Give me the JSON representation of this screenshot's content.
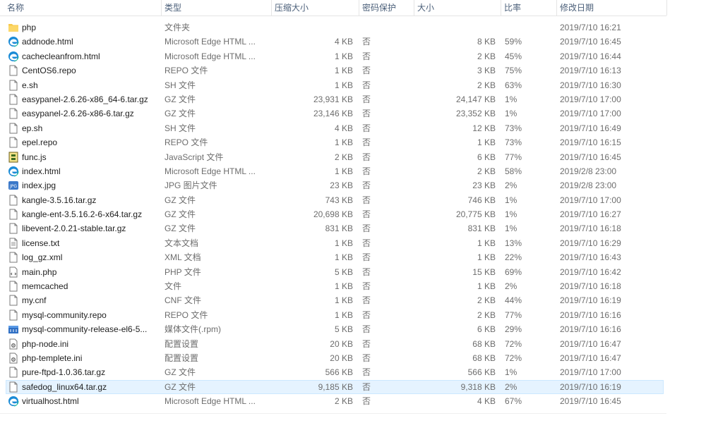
{
  "columns": {
    "name": "名称",
    "type": "类型",
    "compressed": "压缩大小",
    "password": "密码保护",
    "size": "大小",
    "ratio": "比率",
    "modified": "修改日期"
  },
  "colors": {
    "selection": "#e5f3ff",
    "folder": "#f7c94b",
    "edge": "#1b8bd6",
    "header_text": "#4c607a"
  },
  "rows": [
    {
      "icon": "folder-icon",
      "name": "php",
      "type": "文件夹",
      "compressed": "",
      "password": "",
      "size": "",
      "ratio": "",
      "modified": "2019/7/10 16:21"
    },
    {
      "icon": "edge-icon",
      "name": "addnode.html",
      "type": "Microsoft Edge HTML ...",
      "compressed": "4 KB",
      "password": "否",
      "size": "8 KB",
      "ratio": "59%",
      "modified": "2019/7/10 16:45"
    },
    {
      "icon": "edge-icon",
      "name": "cachecleanfrom.html",
      "type": "Microsoft Edge HTML ...",
      "compressed": "1 KB",
      "password": "否",
      "size": "2 KB",
      "ratio": "45%",
      "modified": "2019/7/10 16:44"
    },
    {
      "icon": "file-icon",
      "name": "CentOS6.repo",
      "type": "REPO 文件",
      "compressed": "1 KB",
      "password": "否",
      "size": "3 KB",
      "ratio": "75%",
      "modified": "2019/7/10 16:13"
    },
    {
      "icon": "file-icon",
      "name": "e.sh",
      "type": "SH 文件",
      "compressed": "1 KB",
      "password": "否",
      "size": "2 KB",
      "ratio": "63%",
      "modified": "2019/7/10 16:30"
    },
    {
      "icon": "file-icon",
      "name": "easypanel-2.6.26-x86_64-6.tar.gz",
      "type": "GZ 文件",
      "compressed": "23,931 KB",
      "password": "否",
      "size": "24,147 KB",
      "ratio": "1%",
      "modified": "2019/7/10 17:00"
    },
    {
      "icon": "file-icon",
      "name": "easypanel-2.6.26-x86-6.tar.gz",
      "type": "GZ 文件",
      "compressed": "23,146 KB",
      "password": "否",
      "size": "23,352 KB",
      "ratio": "1%",
      "modified": "2019/7/10 17:00"
    },
    {
      "icon": "file-icon",
      "name": "ep.sh",
      "type": "SH 文件",
      "compressed": "4 KB",
      "password": "否",
      "size": "12 KB",
      "ratio": "73%",
      "modified": "2019/7/10 16:49"
    },
    {
      "icon": "file-icon",
      "name": "epel.repo",
      "type": "REPO 文件",
      "compressed": "1 KB",
      "password": "否",
      "size": "1 KB",
      "ratio": "73%",
      "modified": "2019/7/10 16:15"
    },
    {
      "icon": "js-icon",
      "name": "func.js",
      "type": "JavaScript 文件",
      "compressed": "2 KB",
      "password": "否",
      "size": "6 KB",
      "ratio": "77%",
      "modified": "2019/7/10 16:45"
    },
    {
      "icon": "edge-icon",
      "name": "index.html",
      "type": "Microsoft Edge HTML ...",
      "compressed": "1 KB",
      "password": "否",
      "size": "2 KB",
      "ratio": "58%",
      "modified": "2019/2/8 23:00"
    },
    {
      "icon": "image-icon",
      "name": "index.jpg",
      "type": "JPG 图片文件",
      "compressed": "23 KB",
      "password": "否",
      "size": "23 KB",
      "ratio": "2%",
      "modified": "2019/2/8 23:00"
    },
    {
      "icon": "file-icon",
      "name": "kangle-3.5.16.tar.gz",
      "type": "GZ 文件",
      "compressed": "743 KB",
      "password": "否",
      "size": "746 KB",
      "ratio": "1%",
      "modified": "2019/7/10 17:00"
    },
    {
      "icon": "file-icon",
      "name": "kangle-ent-3.5.16.2-6-x64.tar.gz",
      "type": "GZ 文件",
      "compressed": "20,698 KB",
      "password": "否",
      "size": "20,775 KB",
      "ratio": "1%",
      "modified": "2019/7/10 16:27"
    },
    {
      "icon": "file-icon",
      "name": "libevent-2.0.21-stable.tar.gz",
      "type": "GZ 文件",
      "compressed": "831 KB",
      "password": "否",
      "size": "831 KB",
      "ratio": "1%",
      "modified": "2019/7/10 16:18"
    },
    {
      "icon": "text-file-icon",
      "name": "license.txt",
      "type": "文本文档",
      "compressed": "1 KB",
      "password": "否",
      "size": "1 KB",
      "ratio": "13%",
      "modified": "2019/7/10 16:29"
    },
    {
      "icon": "file-icon",
      "name": "log_gz.xml",
      "type": "XML 文档",
      "compressed": "1 KB",
      "password": "否",
      "size": "1 KB",
      "ratio": "22%",
      "modified": "2019/7/10 16:43"
    },
    {
      "icon": "php-icon",
      "name": "main.php",
      "type": "PHP 文件",
      "compressed": "5 KB",
      "password": "否",
      "size": "15 KB",
      "ratio": "69%",
      "modified": "2019/7/10 16:42"
    },
    {
      "icon": "file-icon",
      "name": "memcached",
      "type": "文件",
      "compressed": "1 KB",
      "password": "否",
      "size": "1 KB",
      "ratio": "2%",
      "modified": "2019/7/10 16:18"
    },
    {
      "icon": "file-icon",
      "name": "my.cnf",
      "type": "CNF 文件",
      "compressed": "1 KB",
      "password": "否",
      "size": "2 KB",
      "ratio": "44%",
      "modified": "2019/7/10 16:19"
    },
    {
      "icon": "file-icon",
      "name": "mysql-community.repo",
      "type": "REPO 文件",
      "compressed": "1 KB",
      "password": "否",
      "size": "2 KB",
      "ratio": "77%",
      "modified": "2019/7/10 16:16"
    },
    {
      "icon": "rpm-icon",
      "name": "mysql-community-release-el6-5...",
      "type": "媒体文件(.rpm)",
      "compressed": "5 KB",
      "password": "否",
      "size": "6 KB",
      "ratio": "29%",
      "modified": "2019/7/10 16:16"
    },
    {
      "icon": "settings-file-icon",
      "name": "php-node.ini",
      "type": "配置设置",
      "compressed": "20 KB",
      "password": "否",
      "size": "68 KB",
      "ratio": "72%",
      "modified": "2019/7/10 16:47"
    },
    {
      "icon": "settings-file-icon",
      "name": "php-templete.ini",
      "type": "配置设置",
      "compressed": "20 KB",
      "password": "否",
      "size": "68 KB",
      "ratio": "72%",
      "modified": "2019/7/10 16:47"
    },
    {
      "icon": "file-icon",
      "name": "pure-ftpd-1.0.36.tar.gz",
      "type": "GZ 文件",
      "compressed": "566 KB",
      "password": "否",
      "size": "566 KB",
      "ratio": "1%",
      "modified": "2019/7/10 17:00"
    },
    {
      "icon": "file-icon",
      "name": "safedog_linux64.tar.gz",
      "type": "GZ 文件",
      "compressed": "9,185 KB",
      "password": "否",
      "size": "9,318 KB",
      "ratio": "2%",
      "modified": "2019/7/10 16:19",
      "selected": true
    },
    {
      "icon": "edge-icon",
      "name": "virtualhost.html",
      "type": "Microsoft Edge HTML ...",
      "compressed": "2 KB",
      "password": "否",
      "size": "4 KB",
      "ratio": "67%",
      "modified": "2019/7/10 16:45"
    }
  ]
}
